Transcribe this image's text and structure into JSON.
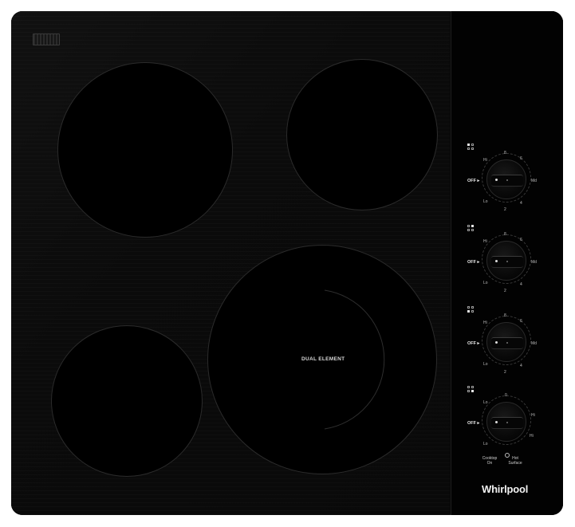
{
  "product": {
    "brand": "Whirlpool",
    "burner_label": "DUAL ELEMENT"
  },
  "controls": [
    {
      "indicator_active": 0,
      "off": "OFF ▸",
      "hi": "Hi",
      "lo": "Lo",
      "marks": [
        "8",
        "6",
        "4",
        "2"
      ],
      "extra": "Md"
    },
    {
      "indicator_active": 1,
      "off": "OFF ▸",
      "hi": "Hi",
      "lo": "Lo",
      "marks": [
        "8",
        "6",
        "4",
        "2"
      ],
      "extra": "Md"
    },
    {
      "indicator_active": 2,
      "off": "OFF ▸",
      "hi": "Hi",
      "lo": "Lo",
      "marks": [
        "8",
        "6",
        "4",
        "2"
      ],
      "extra": "Md"
    },
    {
      "indicator_active": 3,
      "off": "OFF ▸",
      "hi": "Hi",
      "lo": "Lo",
      "marks": [
        "0",
        "",
        "",
        ""
      ],
      "extra": "Hi"
    }
  ],
  "status": {
    "cooktop_on": "Cooktop On",
    "hot_surface": "Hot Surface"
  },
  "colors": {
    "glass": "#0b0b0b",
    "panel": "#020202",
    "text": "#e6e6e6"
  }
}
